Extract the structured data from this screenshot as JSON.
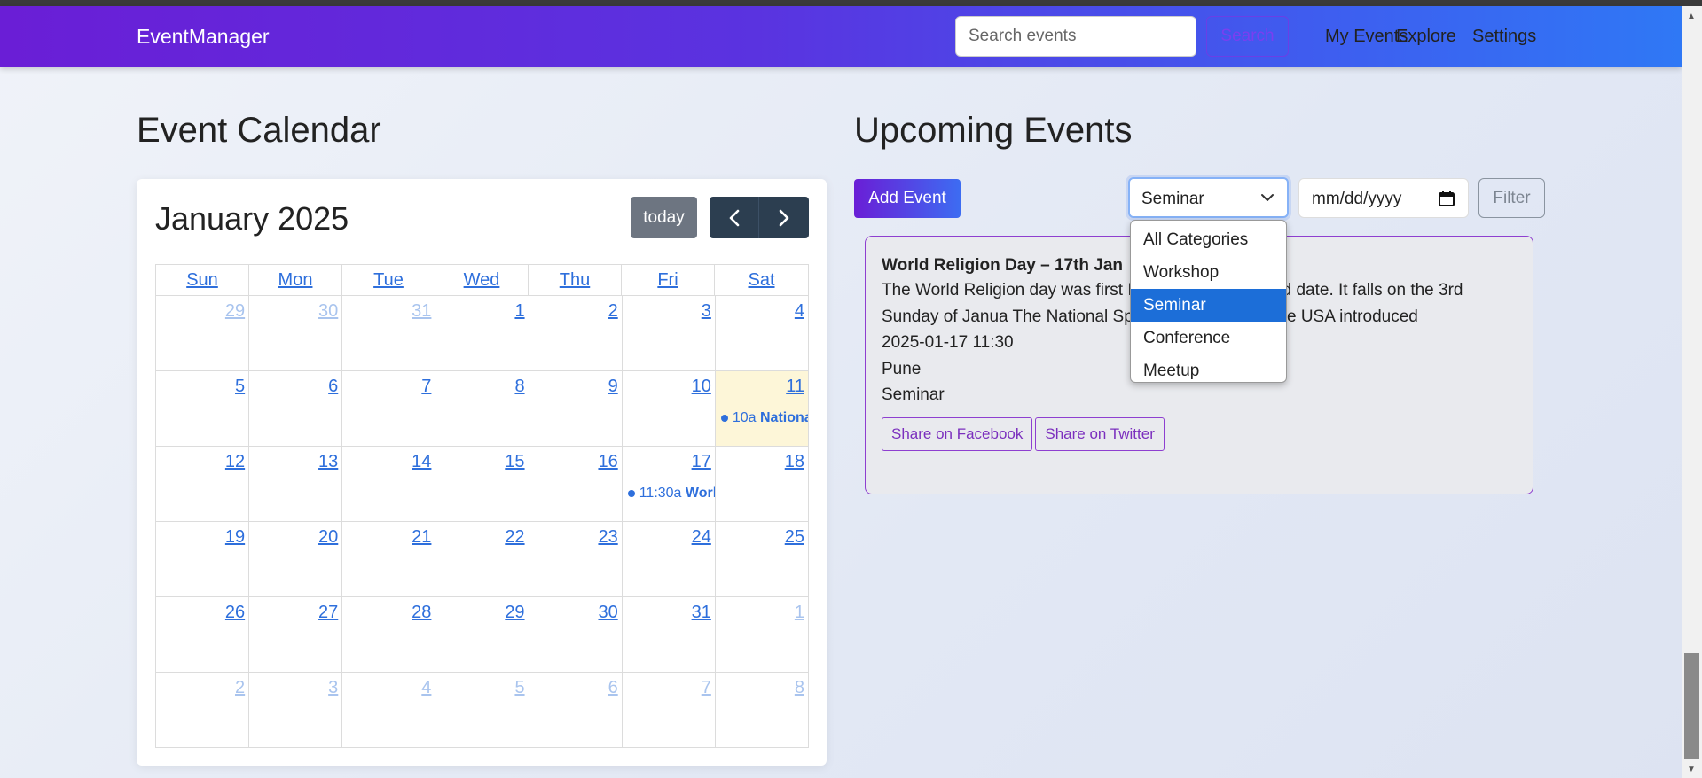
{
  "navbar": {
    "brand": "EventManager",
    "search_placeholder": "Search events",
    "search_button": "Search",
    "links": [
      "My Events",
      "Explore",
      "Settings"
    ]
  },
  "calendar": {
    "section_title": "Event Calendar",
    "month_label": "January 2025",
    "today_button": "today",
    "weekdays": [
      "Sun",
      "Mon",
      "Tue",
      "Wed",
      "Thu",
      "Fri",
      "Sat"
    ],
    "weeks": [
      [
        {
          "d": "29",
          "other": true
        },
        {
          "d": "30",
          "other": true
        },
        {
          "d": "31",
          "other": true
        },
        {
          "d": "1"
        },
        {
          "d": "2"
        },
        {
          "d": "3"
        },
        {
          "d": "4"
        }
      ],
      [
        {
          "d": "5"
        },
        {
          "d": "6"
        },
        {
          "d": "7"
        },
        {
          "d": "8"
        },
        {
          "d": "9"
        },
        {
          "d": "10"
        },
        {
          "d": "11",
          "today": true,
          "event_time": "10a",
          "event_title": "National"
        }
      ],
      [
        {
          "d": "12"
        },
        {
          "d": "13"
        },
        {
          "d": "14"
        },
        {
          "d": "15"
        },
        {
          "d": "16"
        },
        {
          "d": "17",
          "event_time": "11:30a",
          "event_title": "World"
        },
        {
          "d": "18"
        }
      ],
      [
        {
          "d": "19"
        },
        {
          "d": "20"
        },
        {
          "d": "21"
        },
        {
          "d": "22"
        },
        {
          "d": "23"
        },
        {
          "d": "24"
        },
        {
          "d": "25"
        }
      ],
      [
        {
          "d": "26"
        },
        {
          "d": "27"
        },
        {
          "d": "28"
        },
        {
          "d": "29"
        },
        {
          "d": "30"
        },
        {
          "d": "31"
        },
        {
          "d": "1",
          "other": true
        }
      ],
      [
        {
          "d": "2",
          "other": true
        },
        {
          "d": "3",
          "other": true
        },
        {
          "d": "4",
          "other": true
        },
        {
          "d": "5",
          "other": true
        },
        {
          "d": "6",
          "other": true
        },
        {
          "d": "7",
          "other": true
        },
        {
          "d": "8",
          "other": true
        }
      ]
    ]
  },
  "upcoming": {
    "section_title": "Upcoming Events",
    "add_button": "Add Event",
    "category_selected": "Seminar",
    "category_options": [
      "All Categories",
      "Workshop",
      "Seminar",
      "Conference",
      "Meetup"
    ],
    "date_placeholder": "mm/dd/yyyy",
    "filter_button": "Filter",
    "event": {
      "title": "World Religion Day – 17th Jan",
      "description": "The World Religion day was first It doesn’t have a fixed date. It falls on the 3rd Sunday of Janua The National Spiritual Assembly in the USA introduced",
      "datetime": "2025-01-17 11:30",
      "location": "Pune",
      "category": "Seminar",
      "share_facebook": "Share on Facebook",
      "share_twitter": "Share on Twitter"
    }
  },
  "colors": {
    "nav_gradient_start": "#6a1ed6",
    "nav_gradient_end": "#2f78f5",
    "link_blue": "#2e6fdc",
    "accent_purple": "#8e3fd0",
    "selected_option": "#1c6ed8",
    "today_highlight": "#fdf6d8"
  }
}
